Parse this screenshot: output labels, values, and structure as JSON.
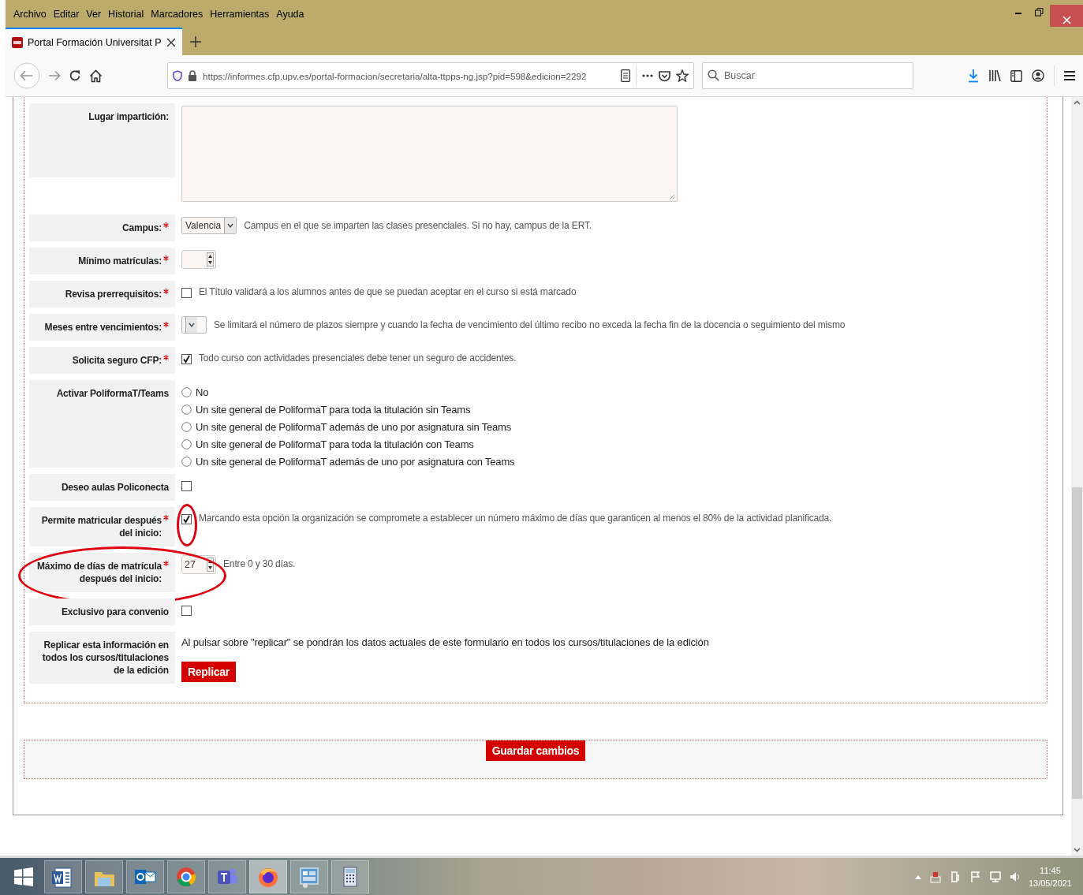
{
  "menu_bar": {
    "items": [
      "Archivo",
      "Editar",
      "Ver",
      "Historial",
      "Marcadores",
      "Herramientas",
      "Ayuda"
    ]
  },
  "tabs": [
    {
      "title": "Portal Formación Universitat P",
      "selected": true
    }
  ],
  "address_bar": {
    "url": "https://informes.cfp.upv.es/portal-formacion/secretaria/alta-ttpps-ng.jsp?pid=598&edicion=2292"
  },
  "search": {
    "placeholder": "Buscar"
  },
  "form": {
    "rows": [
      {
        "kind": "textarea",
        "label": "Lugar impartición:",
        "required": false
      },
      {
        "kind": "select",
        "label": "Campus:",
        "required": true,
        "value": "Valencia",
        "help": "Campus en el que se imparten las clases presenciales. Si no hay, campus de la ERT."
      },
      {
        "kind": "number",
        "label": "Mínimo matrículas:",
        "required": true
      },
      {
        "kind": "checkbox",
        "label": "Revisa prerrequisitos:",
        "required": true,
        "checked": false,
        "help": "El Título validará a los alumnos antes de que se puedan aceptar en el curso si está marcado"
      },
      {
        "kind": "select",
        "label": "Meses entre vencimientos:",
        "required": true,
        "help": "Se limitará el número de plazos siempre y cuando la fecha de vencimiento del último recibo no exceda la fecha fin de la docencia o seguimiento del mismo"
      },
      {
        "kind": "checkbox",
        "label": "Solicita seguro CFP:",
        "required": true,
        "checked": true,
        "help": "Todo curso con actividades presenciales debe tener un seguro de accidentes."
      },
      {
        "kind": "radio",
        "label": "Activar PoliformaT/Teams",
        "required": false,
        "options": [
          {
            "label": "No",
            "selected": false
          },
          {
            "label": "Un site general de PoliformaT para toda la titulación sin Teams",
            "selected": false
          },
          {
            "label": "Un site general de PoliformaT además de uno por asignatura sin Teams",
            "selected": false
          },
          {
            "label": "Un site general de PoliformaT para toda la titulación con Teams",
            "selected": false
          },
          {
            "label": "Un site general de PoliformaT además de uno por asignatura con Teams",
            "selected": false
          }
        ]
      },
      {
        "kind": "checkbox",
        "label": "Deseo aulas Policonecta",
        "required": false,
        "checked": false
      },
      {
        "kind": "checkbox",
        "label": "Permite matricular después del inicio:",
        "required": true,
        "checked": true,
        "highlighted": true,
        "help": "Marcando esta opción la organización se compromete a establecer un número máximo de días que garanticen al menos el 80% de la actividad planificada."
      },
      {
        "kind": "number",
        "label": "Máximo de días de matrícula después del inicio:",
        "required": true,
        "value": "27",
        "highlighted": true,
        "help": "Entre 0 y 30 días."
      },
      {
        "kind": "checkbox",
        "label": "Exclusivo para convenio",
        "required": false,
        "checked": false
      },
      {
        "kind": "button",
        "label": "Replicar esta información en todos los cursos/titulaciones de la edición",
        "required": false,
        "help": "Al pulsar sobre \"replicar\" se pondrán los datos actuales de este formulario en todos los cursos/titulaciones de la edición",
        "button": "Replicar"
      }
    ]
  },
  "save_button": "Guardar cambios",
  "clock": {
    "time": "11:45",
    "date": "13/05/2021"
  }
}
